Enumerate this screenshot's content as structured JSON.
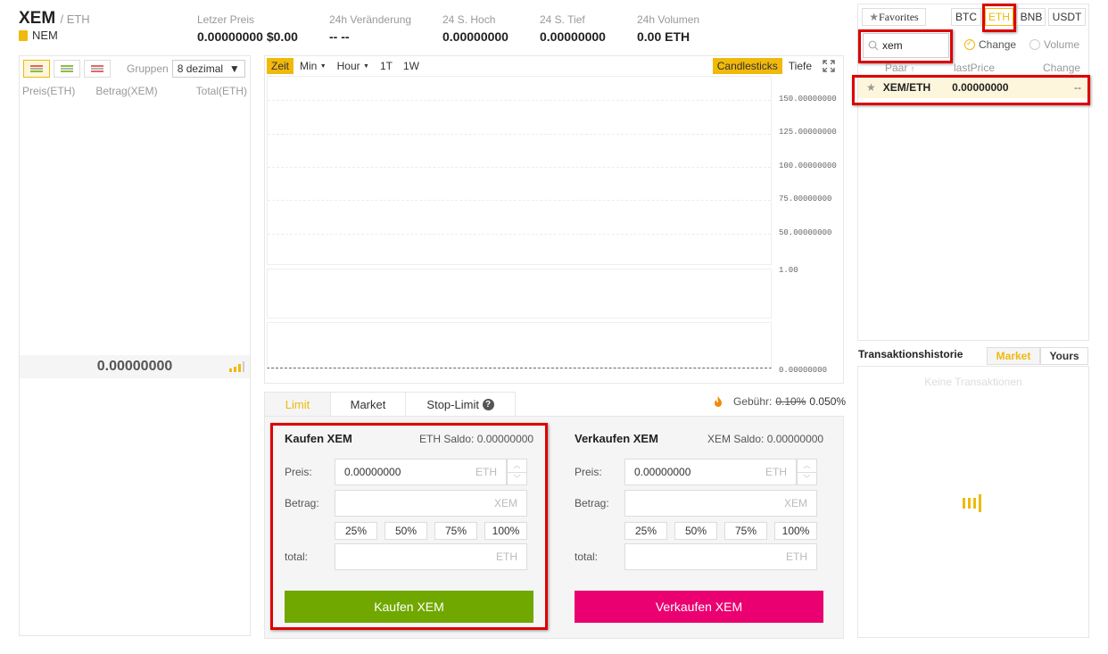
{
  "header": {
    "symbol": "XEM",
    "quote": "/ ETH",
    "coin_name": "NEM",
    "stats": [
      {
        "label": "Letzer Preis",
        "value": "0.00000000 $0.00"
      },
      {
        "label": "24h Veränderung",
        "value": "-- --"
      },
      {
        "label": "24 S. Hoch",
        "value": "0.00000000"
      },
      {
        "label": "24 S. Tief",
        "value": "0.00000000"
      },
      {
        "label": "24h Volumen",
        "value": "0.00 ETH"
      }
    ]
  },
  "orderbook": {
    "groups_label": "Gruppen",
    "groups_value": "8 dezimal",
    "columns": [
      "Preis(ETH)",
      "Betrag(XEM)",
      "Total(ETH)"
    ],
    "mid_price": "0.00000000"
  },
  "chart": {
    "tools_left": [
      "Zeit",
      "Min",
      "Hour",
      "1T",
      "1W"
    ],
    "tools_right": [
      "Candlesticks",
      "Tiefe"
    ],
    "y_ticks": [
      "150.00000000",
      "125.00000000",
      "100.00000000",
      "75.00000000",
      "50.00000000"
    ],
    "vol_tick": "1.00",
    "bottom_tick": "0.00000000"
  },
  "trade": {
    "tabs": [
      "Limit",
      "Market",
      "Stop-Limit"
    ],
    "fee_label": "Gebühr:",
    "fee_old": "0.10%",
    "fee_new": "0.050%",
    "buy": {
      "title": "Kaufen XEM",
      "balance": "ETH Saldo: 0.00000000",
      "price_label": "Preis:",
      "price_value": "0.00000000",
      "price_unit": "ETH",
      "amount_label": "Betrag:",
      "amount_unit": "XEM",
      "total_label": "total:",
      "total_unit": "ETH",
      "pcts": [
        "25%",
        "50%",
        "75%",
        "100%"
      ],
      "button": "Kaufen XEM"
    },
    "sell": {
      "title": "Verkaufen XEM",
      "balance": "XEM Saldo: 0.00000000",
      "price_label": "Preis:",
      "price_value": "0.00000000",
      "price_unit": "ETH",
      "amount_label": "Betrag:",
      "amount_unit": "XEM",
      "total_label": "total:",
      "total_unit": "ETH",
      "pcts": [
        "25%",
        "50%",
        "75%",
        "100%"
      ],
      "button": "Verkaufen XEM"
    }
  },
  "market": {
    "favorites": "Favorites",
    "tabs": [
      "BTC",
      "ETH",
      "BNB",
      "USDT"
    ],
    "search_value": "xem",
    "radio_change": "Change",
    "radio_volume": "Volume",
    "columns": [
      "Paar",
      "lastPrice",
      "Change"
    ],
    "rows": [
      {
        "pair": "XEM/ETH",
        "price": "0.00000000",
        "change": "--"
      }
    ]
  },
  "history": {
    "title": "Transaktionshistorie",
    "tabs": [
      "Market",
      "Yours"
    ],
    "empty": "Keine Transaktionen"
  },
  "colors": {
    "accent": "#f0b90b",
    "buy": "#70a800",
    "sell": "#ea0070",
    "highlight": "#dd0000"
  }
}
